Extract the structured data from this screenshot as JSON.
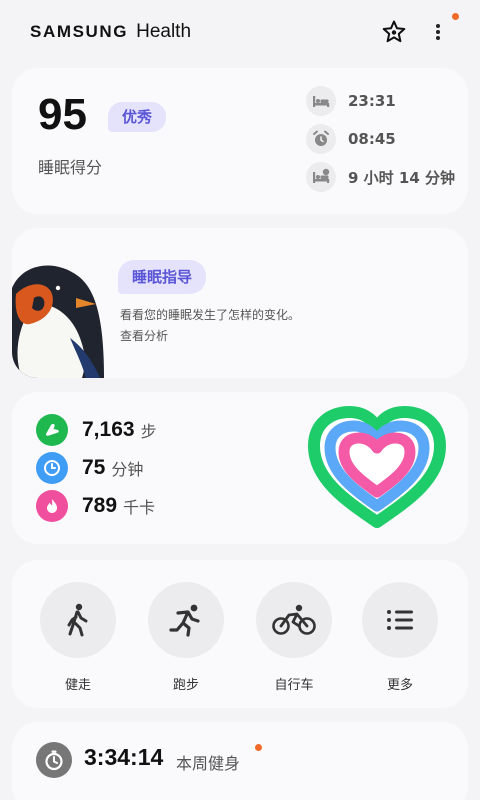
{
  "app": {
    "brand_primary": "SAMSUNG",
    "brand_secondary": "Health",
    "accent_color": "#5a55d6",
    "notification_color": "#f06a2a"
  },
  "header": {
    "icons": [
      "star-icon",
      "more-options-icon"
    ]
  },
  "sleep": {
    "score": "95",
    "badge": "优秀",
    "label": "睡眠得分",
    "bedtime": "23:31",
    "wake_time": "08:45",
    "duration": "9 小时 14 分钟",
    "icons": [
      "bed-icon",
      "alarm-icon",
      "sleep-duration-icon"
    ]
  },
  "coaching": {
    "badge": "睡眠指导",
    "text": "看看您的睡眠发生了怎样的变化。",
    "link": "查看分析"
  },
  "activity": {
    "steps_value": "7,163",
    "steps_unit": "步",
    "active_minutes_value": "75",
    "active_minutes_unit": "分钟",
    "calories_value": "789",
    "calories_unit": "千卡",
    "colors": {
      "steps": "#1fb84f",
      "minutes": "#3f9df5",
      "calories": "#f04f9e"
    }
  },
  "workouts": {
    "items": [
      {
        "label": "健走",
        "icon": "walking-icon"
      },
      {
        "label": "跑步",
        "icon": "running-icon"
      },
      {
        "label": "自行车",
        "icon": "cycling-icon"
      },
      {
        "label": "更多",
        "icon": "list-icon"
      }
    ]
  },
  "weekly": {
    "time": "3:34:14",
    "label": "本周健身"
  }
}
